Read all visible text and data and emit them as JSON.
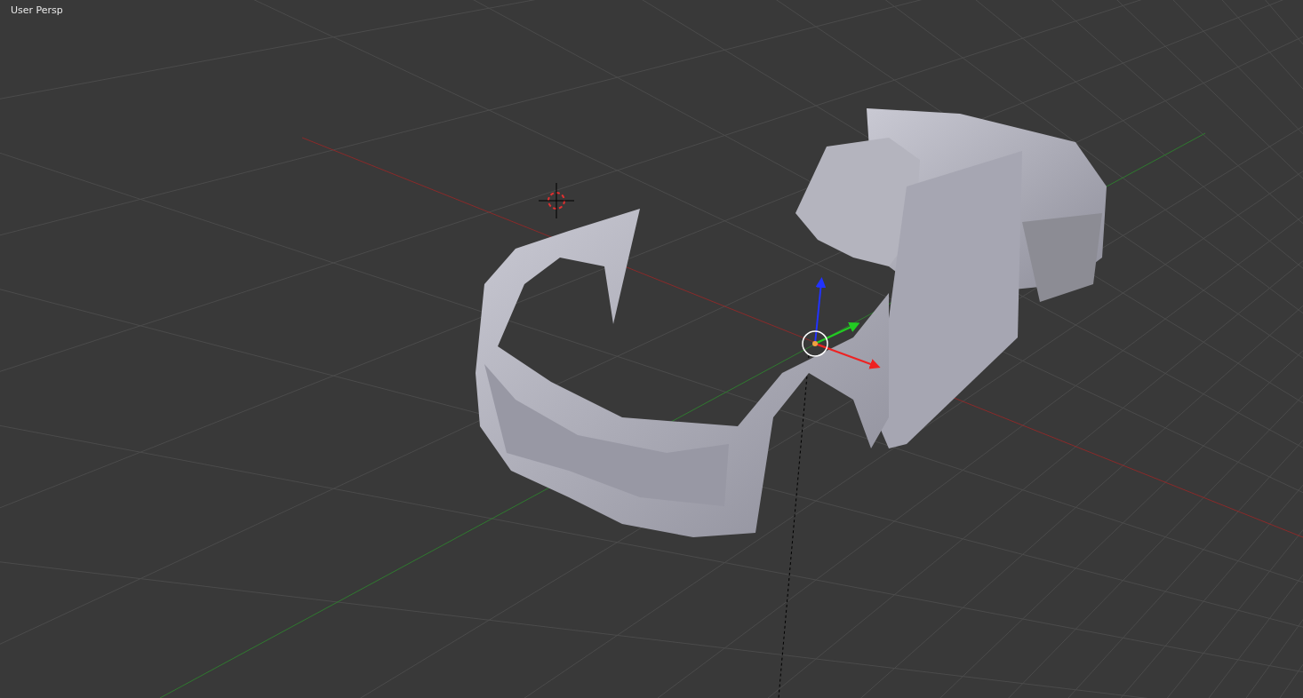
{
  "viewport": {
    "view_label": "User Persp"
  }
}
